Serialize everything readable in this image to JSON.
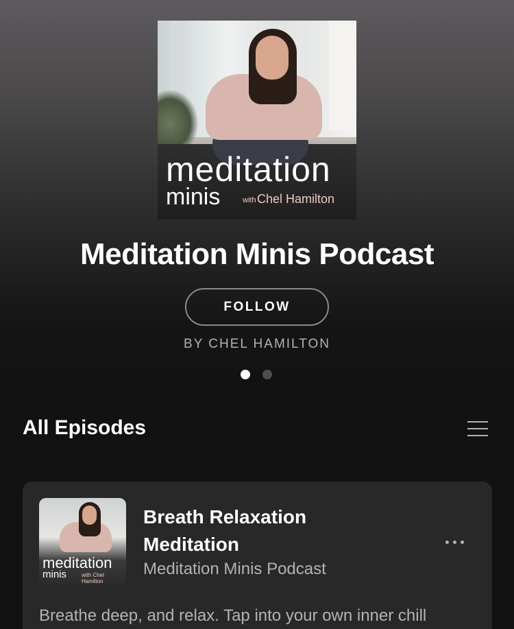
{
  "podcast": {
    "cover_art": {
      "line1": "meditation",
      "line2": "minis",
      "with": "with",
      "host": "Chel Hamilton"
    },
    "title": "Meditation Minis Podcast",
    "follow_label": "FOLLOW",
    "byline": "BY CHEL HAMILTON",
    "pager": {
      "total": 2,
      "active_index": 0
    }
  },
  "episodes_section": {
    "title": "All Episodes",
    "sort_icon": "hamburger-menu-icon"
  },
  "episodes": [
    {
      "title": "Breath Relaxation Meditation",
      "show": "Meditation Minis Podcast",
      "description": "Breathe deep, and relax. Tap into your own inner chill",
      "thumb": {
        "line1": "meditation",
        "line2": "minis",
        "host": "with Chel Hamilton"
      },
      "more_icon": "more-options-icon"
    }
  ],
  "colors": {
    "background": "#121212",
    "card": "#282828",
    "text_primary": "#ffffff",
    "text_secondary": "#b3b3b3"
  }
}
